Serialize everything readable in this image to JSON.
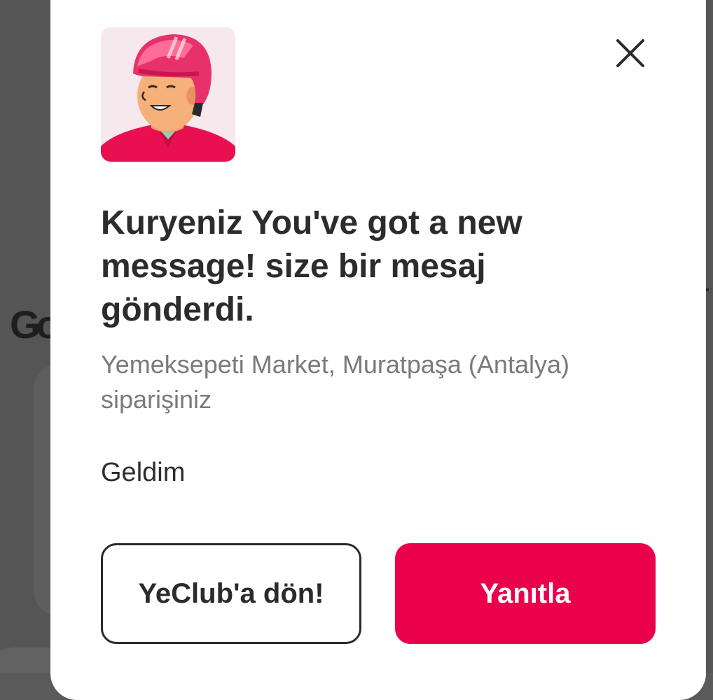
{
  "colors": {
    "backdrop": "#555555",
    "modal_background": "#ffffff",
    "primary_button": "#ea004b",
    "title_text": "#2c2c2c",
    "subtitle_text": "#7a7a7a"
  },
  "background": {
    "logo_text": "Go"
  },
  "dialog": {
    "avatar_icon": "courier-helmet-avatar",
    "close_icon": "close-x-icon",
    "title": "Kuryeniz You've got a new message! size bir mesaj gönderdi.",
    "subtitle": "Yemeksepeti Market, Muratpaşa (Antalya) siparişiniz",
    "message": "Geldim",
    "secondary_button_label": "YeClub'a dön!",
    "primary_button_label": "Yanıtla"
  }
}
